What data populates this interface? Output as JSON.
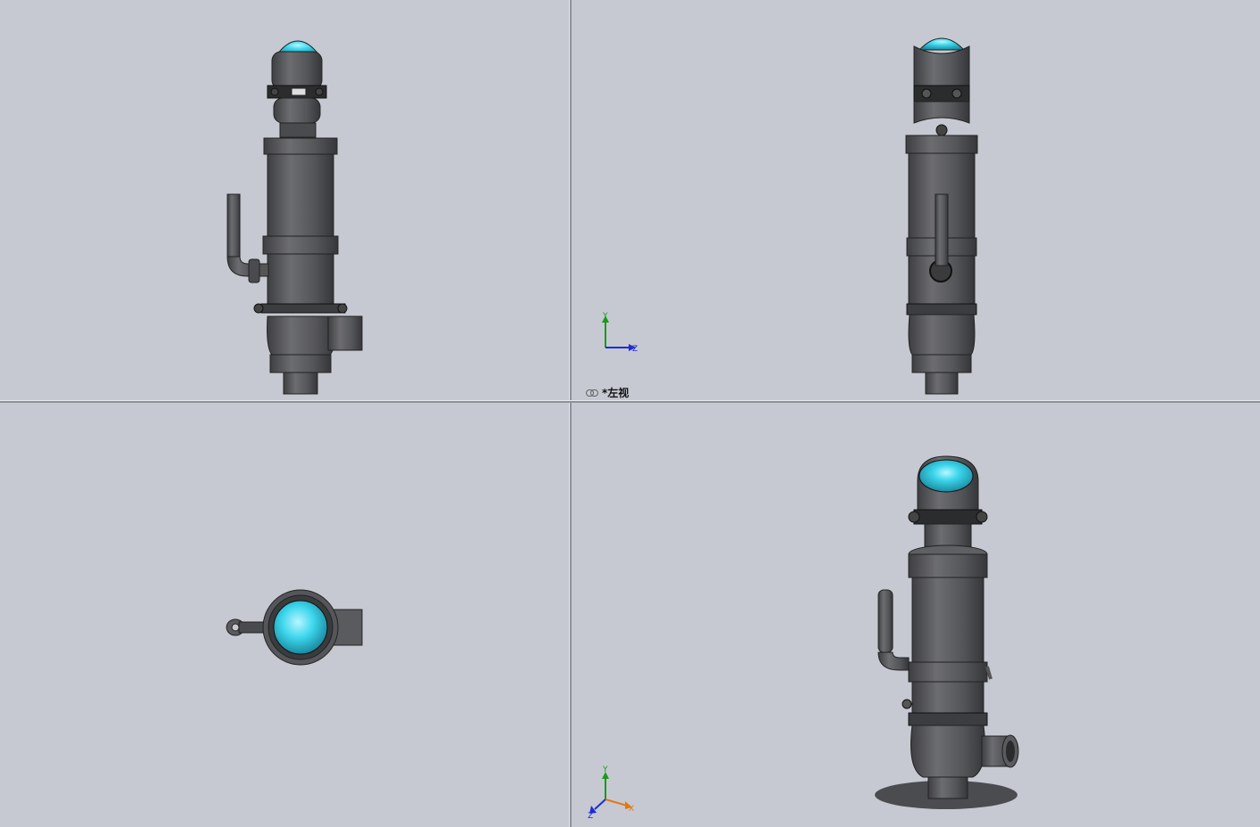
{
  "viewports": {
    "front": {
      "name": "front-view"
    },
    "left": {
      "name": "left-view",
      "label": "*左视"
    },
    "top": {
      "name": "top-view"
    },
    "iso": {
      "name": "isometric-view"
    }
  },
  "triad_left": {
    "y": "Y",
    "z": "Z"
  },
  "triad_iso": {
    "y": "Y",
    "x": "X",
    "z": "Z"
  },
  "colors": {
    "background": "#c6c9d2",
    "body": "#5a5b5e",
    "body_dark": "#3a3b3d",
    "dome": "#3cd6ec",
    "axis_y": "#1a9a1a",
    "axis_z": "#1f2bd6",
    "axis_x": "#d62020"
  },
  "icons": [
    "link-icon",
    "coordinate-triad-icon"
  ]
}
